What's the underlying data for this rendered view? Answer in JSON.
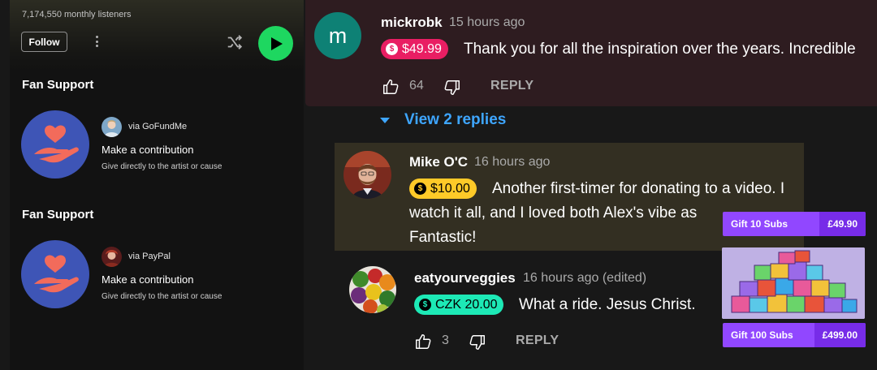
{
  "player": {
    "monthly_listeners": "7,174,550 monthly listeners",
    "follow_label": "Follow",
    "accent_color": "#1ed760"
  },
  "fan_support": [
    {
      "section_title": "Fan Support",
      "via": "via GoFundMe",
      "action": "Make a contribution",
      "description": "Give directly to the artist or cause"
    },
    {
      "section_title": "Fan Support",
      "via": "via PayPal",
      "action": "Make a contribution",
      "description": "Give directly to the artist or cause"
    }
  ],
  "comments": [
    {
      "avatar_letter": "m",
      "author": "mickrobk",
      "time": "15 hours ago",
      "super_thanks": "$49.99",
      "chip_color": "#e91e63",
      "text": "Thank you for all the inspiration over the years. Incredible",
      "likes": "64",
      "reply_label": "REPLY"
    },
    {
      "author": "Mike O'C",
      "time": "16 hours ago",
      "super_thanks": "$10.00",
      "chip_color": "#ffca28",
      "text_line1": "Another first-timer for donating to a video. I",
      "text_line2": "watch it all, and I loved both Alex's vibe as",
      "text_line3": "Fantastic!"
    },
    {
      "author": "eatyourveggies",
      "time": "16 hours ago (edited)",
      "super_thanks": "CZK 20.00",
      "chip_color": "#1de9b6",
      "text": "What a ride. Jesus Christ.",
      "likes": "3",
      "reply_label": "REPLY"
    }
  ],
  "view_replies": "View 2 replies",
  "gift_subs": [
    {
      "label": "Gift 10 Subs",
      "price": "£49.90"
    },
    {
      "label": "Gift 100 Subs",
      "price": "£499.00"
    }
  ],
  "icons": {
    "more": "more-vertical-icon",
    "shuffle": "shuffle-icon",
    "play": "play-icon",
    "like": "thumbs-up-icon",
    "dislike": "thumbs-down-icon",
    "donation_coin": "dollar-coin-icon",
    "heart_hand": "heart-hand-icon"
  }
}
